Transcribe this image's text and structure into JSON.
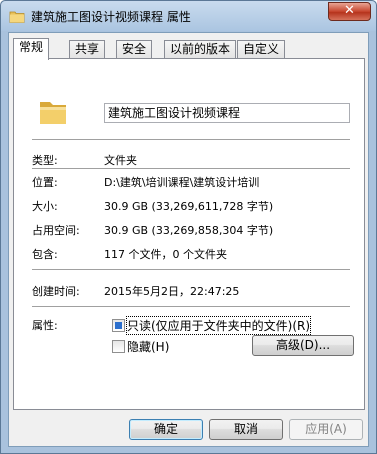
{
  "window": {
    "title": "建筑施工图设计视频课程 属性",
    "close_label": "✕"
  },
  "tabs": [
    {
      "label": "常规",
      "active": true
    },
    {
      "label": "共享",
      "active": false
    },
    {
      "label": "安全",
      "active": false
    },
    {
      "label": "以前的版本",
      "active": false
    },
    {
      "label": "自定义",
      "active": false
    }
  ],
  "general": {
    "folder_name": "建筑施工图设计视频课程",
    "type_label": "类型:",
    "type_value": "文件夹",
    "location_label": "位置:",
    "location_value": "D:\\建筑\\培训课程\\建筑设计培训",
    "size_label": "大小:",
    "size_value": "30.9 GB (33,269,611,728 字节)",
    "size_on_disk_label": "占用空间:",
    "size_on_disk_value": "30.9 GB (33,269,858,304 字节)",
    "contains_label": "包含:",
    "contains_value": "117 个文件，0 个文件夹",
    "created_label": "创建时间:",
    "created_value": "2015年5月2日，22:47:25",
    "attributes_label": "属性:",
    "readonly_label": "只读(仅应用于文件夹中的文件)(R)",
    "hidden_label": "隐藏(H)",
    "advanced_label": "高级(D)..."
  },
  "buttons": {
    "ok": "确定",
    "cancel": "取消",
    "apply": "应用(A)"
  },
  "colors": {
    "accent": "#2c6fcd",
    "folder": "#e8c15a"
  }
}
